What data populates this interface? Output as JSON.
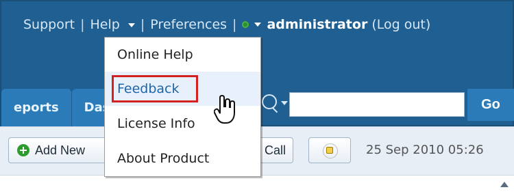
{
  "topnav": {
    "support": "Support",
    "help": "Help",
    "preferences": "Preferences",
    "user": "administrator",
    "logout": "(Log out)",
    "status_color": "#2b8f2b"
  },
  "tabs": [
    {
      "label": "eports"
    },
    {
      "label": "Das"
    }
  ],
  "search": {
    "go_label": "Go",
    "value": "",
    "placeholder": ""
  },
  "toolbar": {
    "add_new": "Add New",
    "call_label": "Call",
    "timestamp": "25 Sep 2010 05:26"
  },
  "help_menu": {
    "items": [
      {
        "label": "Online Help"
      },
      {
        "label": "Feedback"
      },
      {
        "label": "License Info"
      },
      {
        "label": "About Product"
      }
    ]
  },
  "colors": {
    "header_bg": "#1f5f91",
    "tab_bg": "#2a7bb7",
    "highlight_border": "#d32020",
    "hover_bg": "#e8f1fb"
  },
  "icons": {
    "menu_caret": "chevron-down-icon",
    "search": "search-icon",
    "add": "plus-circle-icon",
    "alarm": "alarm-icon",
    "scroll": "scroll-up-icon",
    "cursor": "hand-cursor-icon"
  }
}
